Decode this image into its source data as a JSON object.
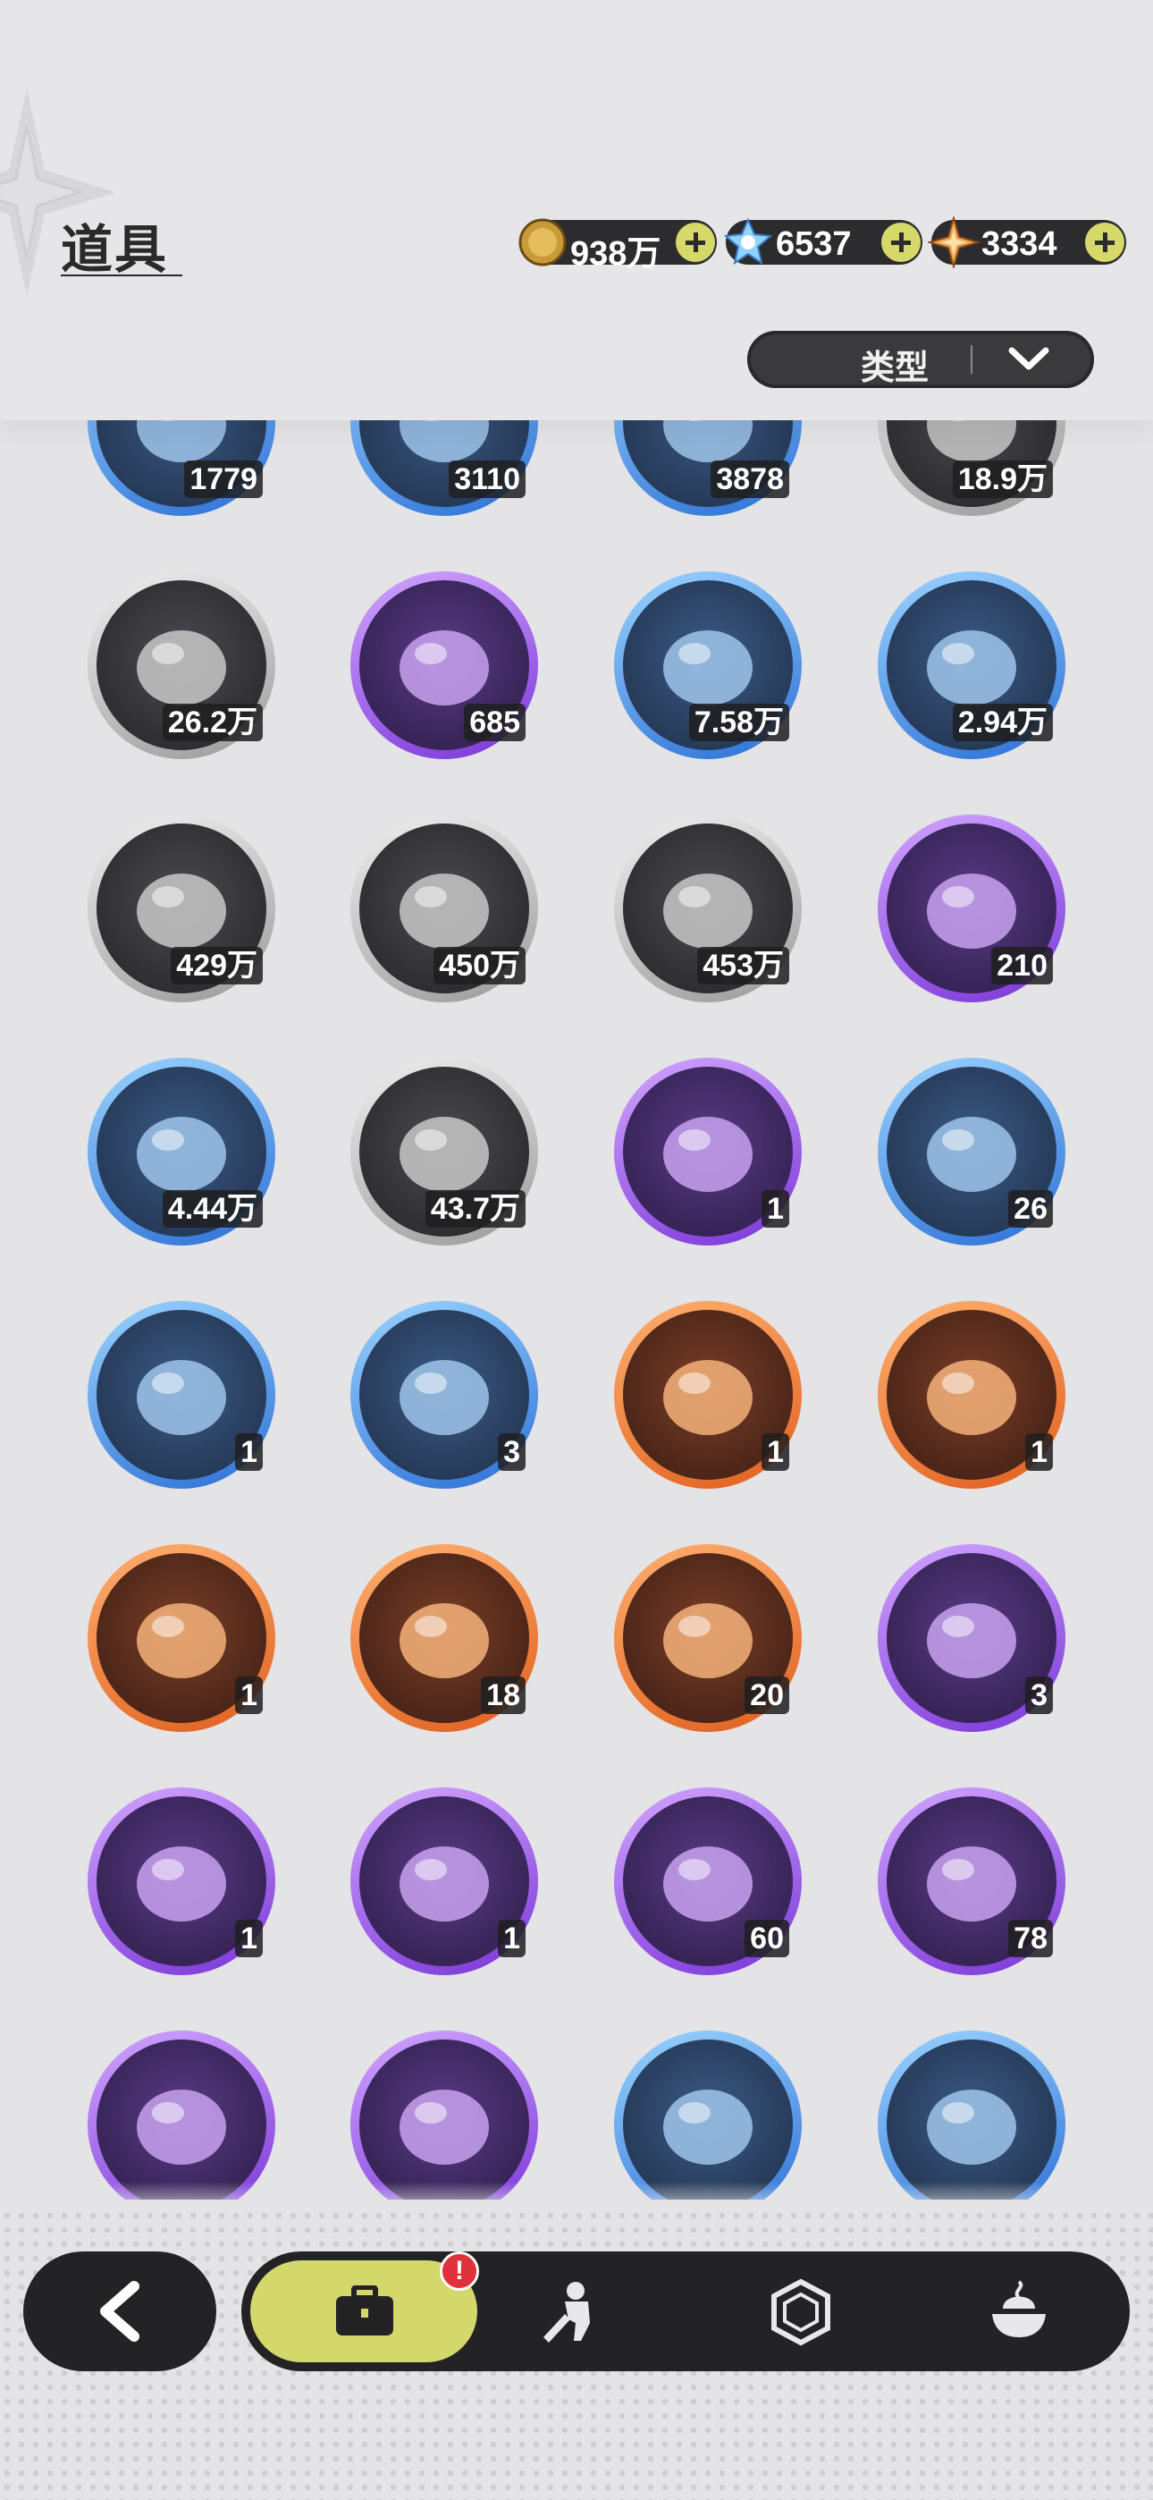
{
  "header": {
    "title": "道具",
    "currencies": [
      {
        "icon": "gold-coin-icon",
        "value": "938万"
      },
      {
        "icon": "crystal-icon",
        "value": "6537"
      },
      {
        "icon": "star-gem-icon",
        "value": "3334"
      }
    ],
    "filter": {
      "label": "类型"
    }
  },
  "items": [
    {
      "icon": "scale-shield-icon",
      "rarity": "blue",
      "count": "1779"
    },
    {
      "icon": "gear-icon",
      "rarity": "blue",
      "count": "3110"
    },
    {
      "icon": "leaf-icon",
      "rarity": "blue",
      "count": "3878"
    },
    {
      "icon": "logs-icon",
      "rarity": "gray",
      "count": "18.9万"
    },
    {
      "icon": "iron-bars-icon",
      "rarity": "gray",
      "count": "26.2万"
    },
    {
      "icon": "gold-crystal-icon",
      "rarity": "purple",
      "count": "685"
    },
    {
      "icon": "gold-dust-icon",
      "rarity": "blue",
      "count": "7.58万"
    },
    {
      "icon": "red-crystal-icon",
      "rarity": "blue",
      "count": "2.94万"
    },
    {
      "icon": "sand-pile-icon",
      "rarity": "gray",
      "count": "429万"
    },
    {
      "icon": "dark-crystal-icon",
      "rarity": "gray",
      "count": "450万"
    },
    {
      "icon": "purple-orb-icon",
      "rarity": "gray",
      "count": "453万"
    },
    {
      "icon": "pet-food-bag-pink-icon",
      "rarity": "purple",
      "count": "210"
    },
    {
      "icon": "pet-food-bag-blue-icon",
      "rarity": "blue",
      "count": "4.44万"
    },
    {
      "icon": "pet-food-bag-brown-icon",
      "rarity": "gray",
      "count": "43.7万"
    },
    {
      "icon": "straw-bundle-icon",
      "rarity": "purple",
      "count": "1"
    },
    {
      "icon": "egg-icon",
      "rarity": "blue",
      "count": "26"
    },
    {
      "icon": "dried-flowers-icon",
      "rarity": "blue",
      "count": "1"
    },
    {
      "icon": "potion-vial-icon",
      "rarity": "blue",
      "count": "3"
    },
    {
      "icon": "rose-bouquet-icon",
      "rarity": "orange",
      "count": "1"
    },
    {
      "icon": "pocket-watch-icon",
      "rarity": "orange",
      "count": "1"
    },
    {
      "icon": "green-potion-icon",
      "rarity": "orange",
      "count": "1"
    },
    {
      "icon": "crown-icon",
      "rarity": "orange",
      "count": "18"
    },
    {
      "icon": "diamond-gift-icon",
      "rarity": "orange",
      "count": "20"
    },
    {
      "icon": "cherry-blossom-bouquet-icon",
      "rarity": "purple",
      "count": "3"
    },
    {
      "icon": "lily-bouquet-icon",
      "rarity": "purple",
      "count": "1"
    },
    {
      "icon": "pillow-icon",
      "rarity": "purple",
      "count": "1"
    },
    {
      "icon": "jade-pendant-icon",
      "rarity": "purple",
      "count": "60"
    },
    {
      "icon": "gold-ingot-icon",
      "rarity": "purple",
      "count": "78"
    },
    {
      "icon": "recipe-book-icon",
      "rarity": "purple",
      "count": ""
    },
    {
      "icon": "weapon-book-icon",
      "rarity": "purple",
      "count": ""
    },
    {
      "icon": "blue-flowers-icon",
      "rarity": "blue",
      "count": ""
    },
    {
      "icon": "yellow-flowers-icon",
      "rarity": "blue",
      "count": ""
    }
  ],
  "nav": {
    "back": "back-arrow-icon",
    "tabs": [
      {
        "icon": "briefcase-icon",
        "active": true,
        "badge": "!"
      },
      {
        "icon": "character-icon",
        "active": false
      },
      {
        "icon": "hexagon-gem-icon",
        "active": false
      },
      {
        "icon": "food-bowl-icon",
        "active": false
      }
    ]
  },
  "colors": {
    "accent": "#d4d76a",
    "dark": "#232325",
    "background": "#e4e4e6",
    "badge": "#e0303a"
  }
}
